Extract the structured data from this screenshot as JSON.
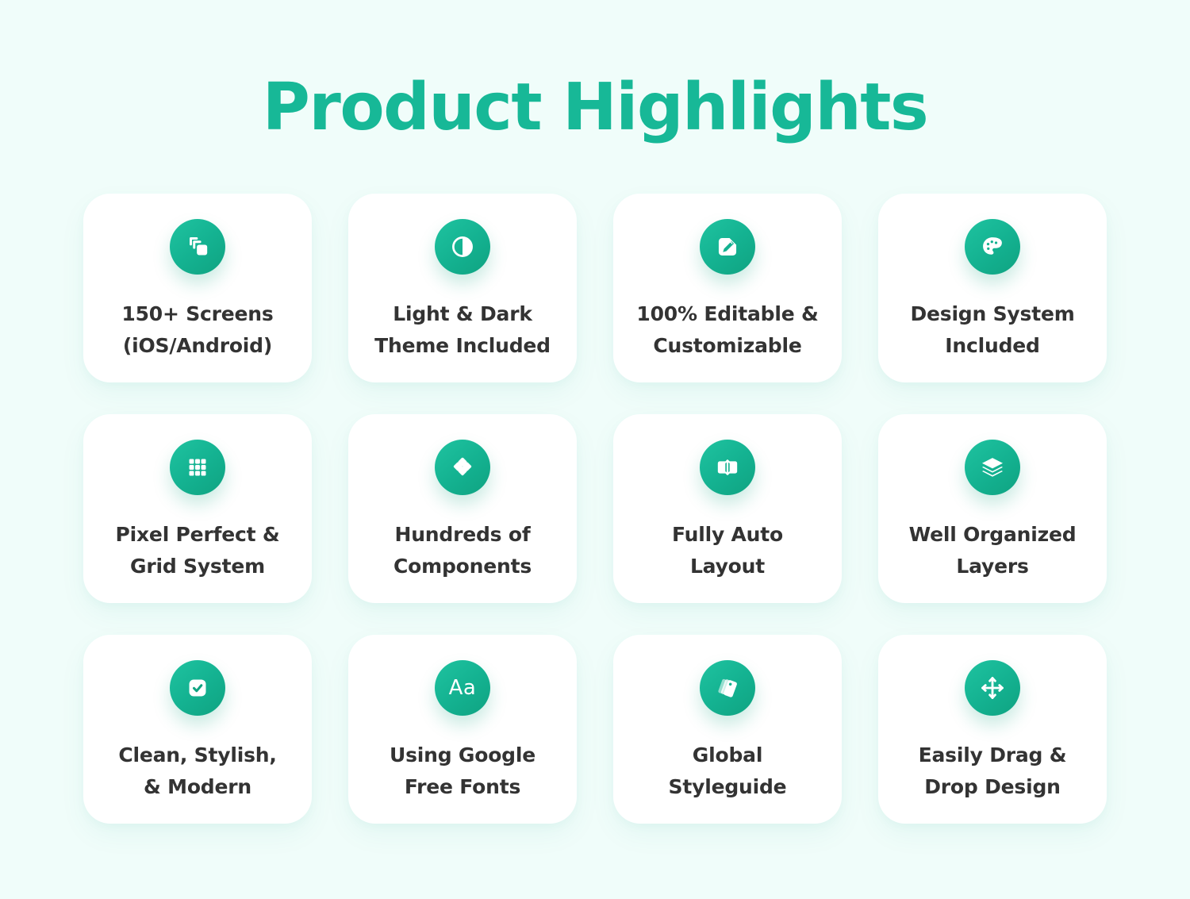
{
  "page": {
    "title": "Product Highlights",
    "background_color": "#f0fdfa",
    "accent_color": "#17b897",
    "title_color": "#17b897",
    "card_background": "#ffffff",
    "label_color": "#333333"
  },
  "cards": [
    {
      "icon": "copy-layers-icon",
      "label": "150+ Screens\n(iOS/Android)"
    },
    {
      "icon": "contrast-icon",
      "label": "Light & Dark\nTheme Included"
    },
    {
      "icon": "pencil-edit-icon",
      "label": "100% Editable &\nCustomizable"
    },
    {
      "icon": "palette-icon",
      "label": "Design System\nIncluded"
    },
    {
      "icon": "grid-3x3-icon",
      "label": "Pixel Perfect &\nGrid System"
    },
    {
      "icon": "components-icon",
      "label": "Hundreds of\nComponents"
    },
    {
      "icon": "auto-layout-icon",
      "label": "Fully Auto\nLayout"
    },
    {
      "icon": "layers-stack-icon",
      "label": "Well Organized\nLayers"
    },
    {
      "icon": "checkbox-icon",
      "label": "Clean, Stylish,\n& Modern"
    },
    {
      "icon": "typography-aa-icon",
      "label": "Using Google\nFree Fonts"
    },
    {
      "icon": "swatches-icon",
      "label": "Global\nStyleguide"
    },
    {
      "icon": "move-arrows-icon",
      "label": "Easily Drag &\nDrop Design"
    }
  ]
}
